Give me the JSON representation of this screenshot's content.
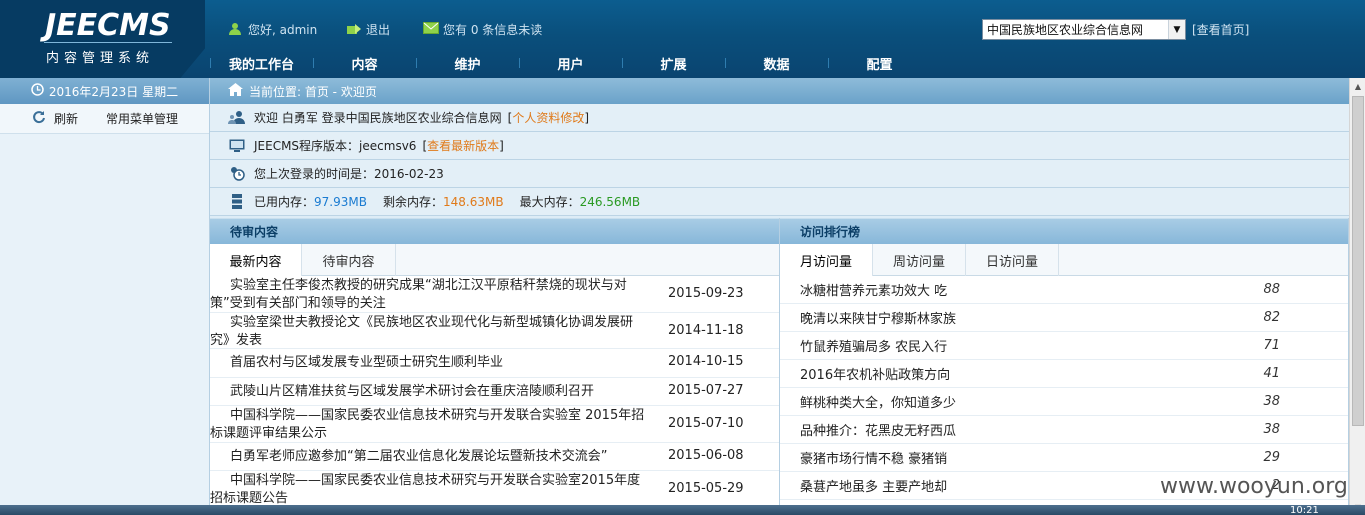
{
  "header": {
    "logo_title": "JEECMS",
    "logo_sub": "内容管理系统",
    "greeting": "您好, admin",
    "logout": "退出",
    "messages": "您有 0 条信息未读",
    "site_select_value": "中国民族地区农业综合信息网",
    "view_home": "[查看首页]"
  },
  "nav": {
    "items": [
      "我的工作台",
      "内容",
      "维护",
      "用户",
      "扩展",
      "数据",
      "配置"
    ]
  },
  "sidebar": {
    "date": "2016年2月23日 星期二",
    "refresh": "刷新",
    "menu_manage": "常用菜单管理"
  },
  "breadcrumb": "当前位置: 首页 - 欢迎页",
  "info": {
    "welcome_prefix": "欢迎 白勇军  登录中国民族地区农业综合信息网",
    "profile_link": "个人资料修改",
    "version_prefix": "JEECMS程序版本：jeecmsv6",
    "version_link": "查看最新版本",
    "last_login": "您上次登录的时间是：2016-02-23",
    "mem_used_label": "已用内存：",
    "mem_used": "97.93MB",
    "mem_free_label": "剩余内存：",
    "mem_free": "148.63MB",
    "mem_max_label": "最大内存：",
    "mem_max": "246.56MB"
  },
  "pending": {
    "title": "待审内容",
    "tabs": [
      "最新内容",
      "待审内容"
    ],
    "rows": [
      {
        "title": "实验室主任李俊杰教授的研究成果“湖北江汉平原秸秆禁烧的现状与对策”受到有关部门和领导的关注",
        "date": "2015-09-23"
      },
      {
        "title": "实验室梁世夫教授论文《民族地区农业现代化与新型城镇化协调发展研究》发表",
        "date": "2014-11-18"
      },
      {
        "title": "首届农村与区域发展专业型硕士研究生顺利毕业",
        "date": "2014-10-15"
      },
      {
        "title": "武陵山片区精准扶贫与区域发展学术研讨会在重庆涪陵顺利召开",
        "date": "2015-07-27"
      },
      {
        "title": "中国科学院——国家民委农业信息技术研究与开发联合实验室 2015年招标课题评审结果公示",
        "date": "2015-07-10"
      },
      {
        "title": "白勇军老师应邀参加“第二届农业信息化发展论坛暨新技术交流会”",
        "date": "2015-06-08"
      },
      {
        "title": "中国科学院——国家民委农业信息技术研究与开发联合实验室2015年度招标课题公告",
        "date": "2015-05-29"
      }
    ]
  },
  "ranking": {
    "title": "访问排行榜",
    "tabs": [
      "月访问量",
      "周访问量",
      "日访问量"
    ],
    "rows": [
      {
        "name": "冰糖柑营养元素功效大 吃",
        "count": "88"
      },
      {
        "name": "晚清以来陕甘宁穆斯林家族",
        "count": "82"
      },
      {
        "name": "竹鼠养殖骗局多 农民入行",
        "count": "71"
      },
      {
        "name": "2016年农机补贴政策方向",
        "count": "41"
      },
      {
        "name": "鲜桃种类大全，你知道多少",
        "count": "38"
      },
      {
        "name": "品种推介：花黑皮无籽西瓜",
        "count": "38"
      },
      {
        "name": "豪猪市场行情不稳 豪猪销",
        "count": "29"
      },
      {
        "name": "桑葚产地虽多 主要产地却",
        "count": "2"
      }
    ]
  },
  "watermark": "www.wooyun.org",
  "clock": "10:21"
}
